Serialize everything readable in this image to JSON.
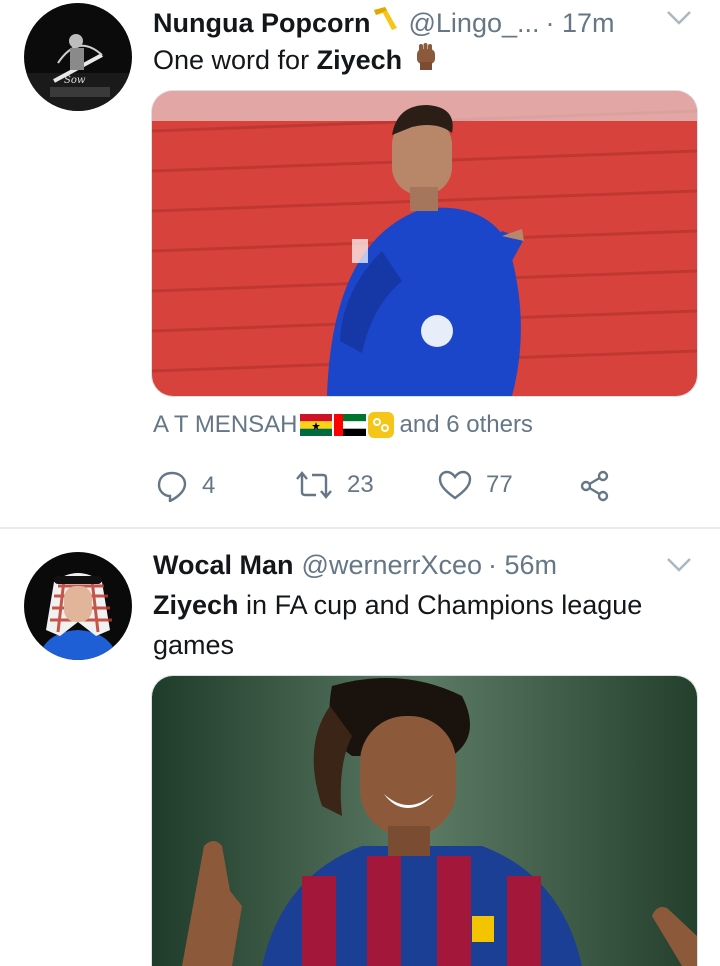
{
  "tweets": [
    {
      "name": "Nungua Popcorn",
      "handle": "@Lingo_...",
      "time": "· 17m",
      "text_prefix": "One word for ",
      "text_bold": "Ziyech",
      "liked_by": "A T MENSAH",
      "liked_suffix": "and 6 others",
      "replies": "4",
      "retweets": "23",
      "likes": "77",
      "name_emoji_icon": "boomerang-icon",
      "text_emoji_icon": "raised-fist-icon"
    },
    {
      "name": "Wocal Man",
      "handle": "@wernerrXceo",
      "time": "· 56m",
      "text_bold": "Ziyech",
      "text_rest": " in FA cup and Champions league games"
    }
  ],
  "colors": {
    "secondary_text": "#657786",
    "primary_text": "#14171a",
    "divider": "#e6ecf0"
  }
}
